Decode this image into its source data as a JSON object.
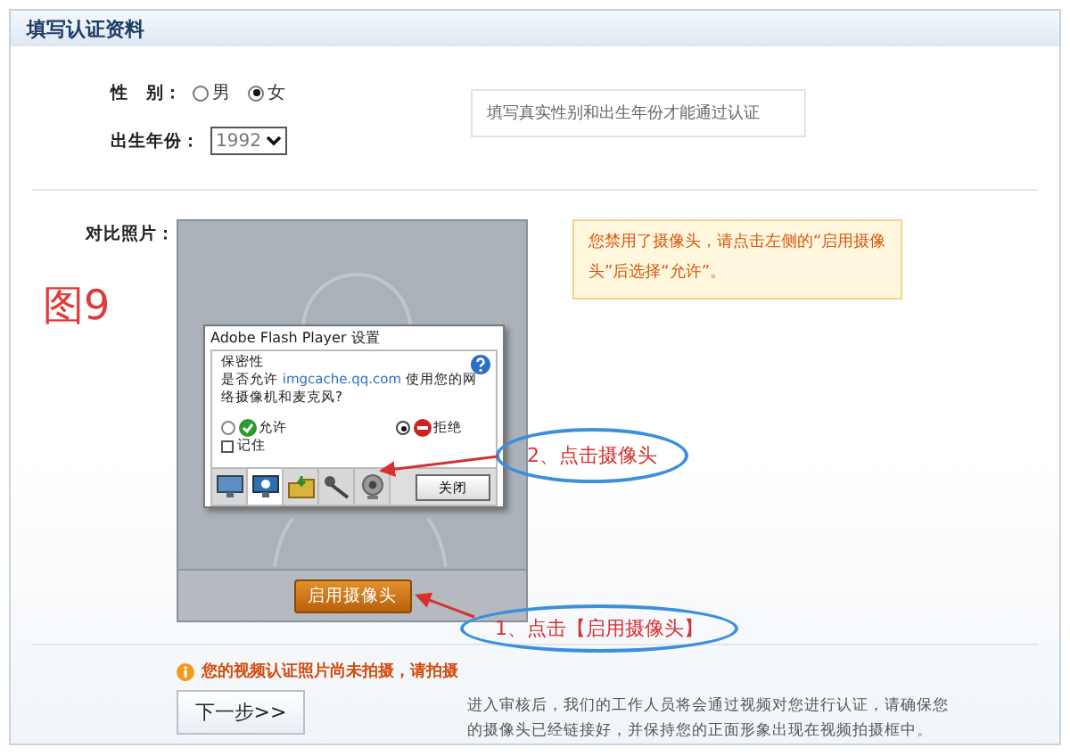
{
  "panel": {
    "title": "填写认证资料"
  },
  "figure_label": "图9",
  "gender": {
    "label": "性　别：",
    "options": [
      {
        "label": "男",
        "selected": false
      },
      {
        "label": "女",
        "selected": true
      }
    ]
  },
  "birth_year": {
    "label": "出生年份：",
    "value": "1992"
  },
  "hint": "填写真实性别和出生年份才能通过认证",
  "photo": {
    "label": "对比照片：",
    "button": "启用摄像头"
  },
  "camera_tip": "您禁用了摄像头，请点击左侧的“启用摄像头”后选择“允许”。",
  "flash_dialog": {
    "title": "Adobe Flash Player 设置",
    "heading": "保密性",
    "question_before": "是否允许 ",
    "domain": "imgcache.qq.com",
    "question_after": " 使用您的网络摄像机和麦克风?",
    "choices": [
      {
        "label": "允许",
        "kind": "allow",
        "selected": false
      },
      {
        "label": "拒绝",
        "kind": "deny",
        "selected": true
      }
    ],
    "remember": {
      "label": "记住",
      "checked": false
    },
    "tabs": [
      {
        "kind": "display",
        "selected": false
      },
      {
        "kind": "privacy",
        "selected": true
      },
      {
        "kind": "storage",
        "selected": false
      },
      {
        "kind": "microphone",
        "selected": false
      },
      {
        "kind": "camera",
        "selected": false
      }
    ],
    "close": "关闭"
  },
  "annotations": [
    {
      "text": "2、点击摄像头"
    },
    {
      "text": "1、点击【启用摄像头】"
    }
  ],
  "warning": "您的视频认证照片尚未拍摄，请拍摄",
  "next_button": "下一步>>",
  "note": "进入审核后，我们的工作人员将会通过视频对您进行认证，请确保您的摄像头已经链接好，并保持您的正面形象出现在视频拍摄框中。"
}
